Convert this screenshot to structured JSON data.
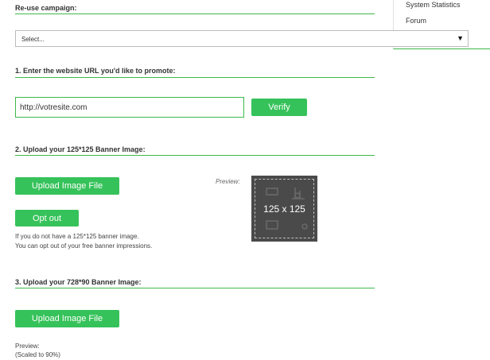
{
  "reuse": {
    "label": "Re-use campaign:",
    "select_value": "Select..."
  },
  "sidebar": {
    "items": [
      "System Statistics",
      "Forum"
    ]
  },
  "step1": {
    "title": "1. Enter the website URL you'd like to promote:",
    "url_value": "http://votresite.com",
    "verify_label": "Verify"
  },
  "step2": {
    "title": "2. Upload your 125*125 Banner Image:",
    "upload_label": "Upload Image File",
    "optout_label": "Opt out",
    "help_line1": "If you do not have a 125*125 banner image.",
    "help_line2": "You can opt out of your free banner impressions.",
    "preview_label": "Preview:",
    "preview_size": "125 x 125"
  },
  "step3": {
    "title": "3. Upload your 728*90 Banner Image:",
    "upload_label": "Upload Image File",
    "preview_label": "Preview:",
    "scaled_note": "(Scaled to 90%)"
  },
  "colors": {
    "accent": "#36c25a",
    "line": "#3cb94a",
    "preview_bg": "#4a4a4a"
  }
}
